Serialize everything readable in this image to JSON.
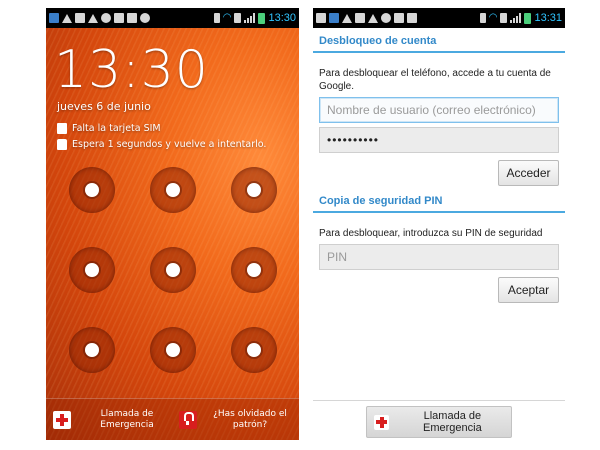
{
  "lock_screen": {
    "status_time": "13:30",
    "clock": "13:30",
    "date": "jueves 6 de junio",
    "notices": [
      {
        "text": "Falta la tarjeta SIM",
        "icon": "sim-card-icon"
      },
      {
        "text": "Espera 1 segundos y vuelve a intentarlo.",
        "icon": "lock-icon"
      }
    ],
    "emergency_label": "Llamada de\nEmergencia",
    "forgot_pattern_label": "¿Has olvidado el\npatrón?"
  },
  "unlock_screen": {
    "status_time": "13:31",
    "account_section": {
      "title": "Desbloqueo de cuenta",
      "description": "Para desbloquear el teléfono, accede a tu cuenta de Google.",
      "username_placeholder": "Nombre de usuario (correo electrónico)",
      "password_value": "••••••••••",
      "submit_label": "Acceder"
    },
    "pin_section": {
      "title": "Copia de seguridad PIN",
      "description": "Para desbloquear, introduzca su PIN de seguridad",
      "pin_placeholder": "PIN",
      "submit_label": "Aceptar"
    },
    "emergency_label": "Llamada de Emergencia"
  },
  "colors": {
    "accent_blue": "#3289c9",
    "emergency_red": "#d81e1e",
    "status_time": "#30c5ff"
  }
}
